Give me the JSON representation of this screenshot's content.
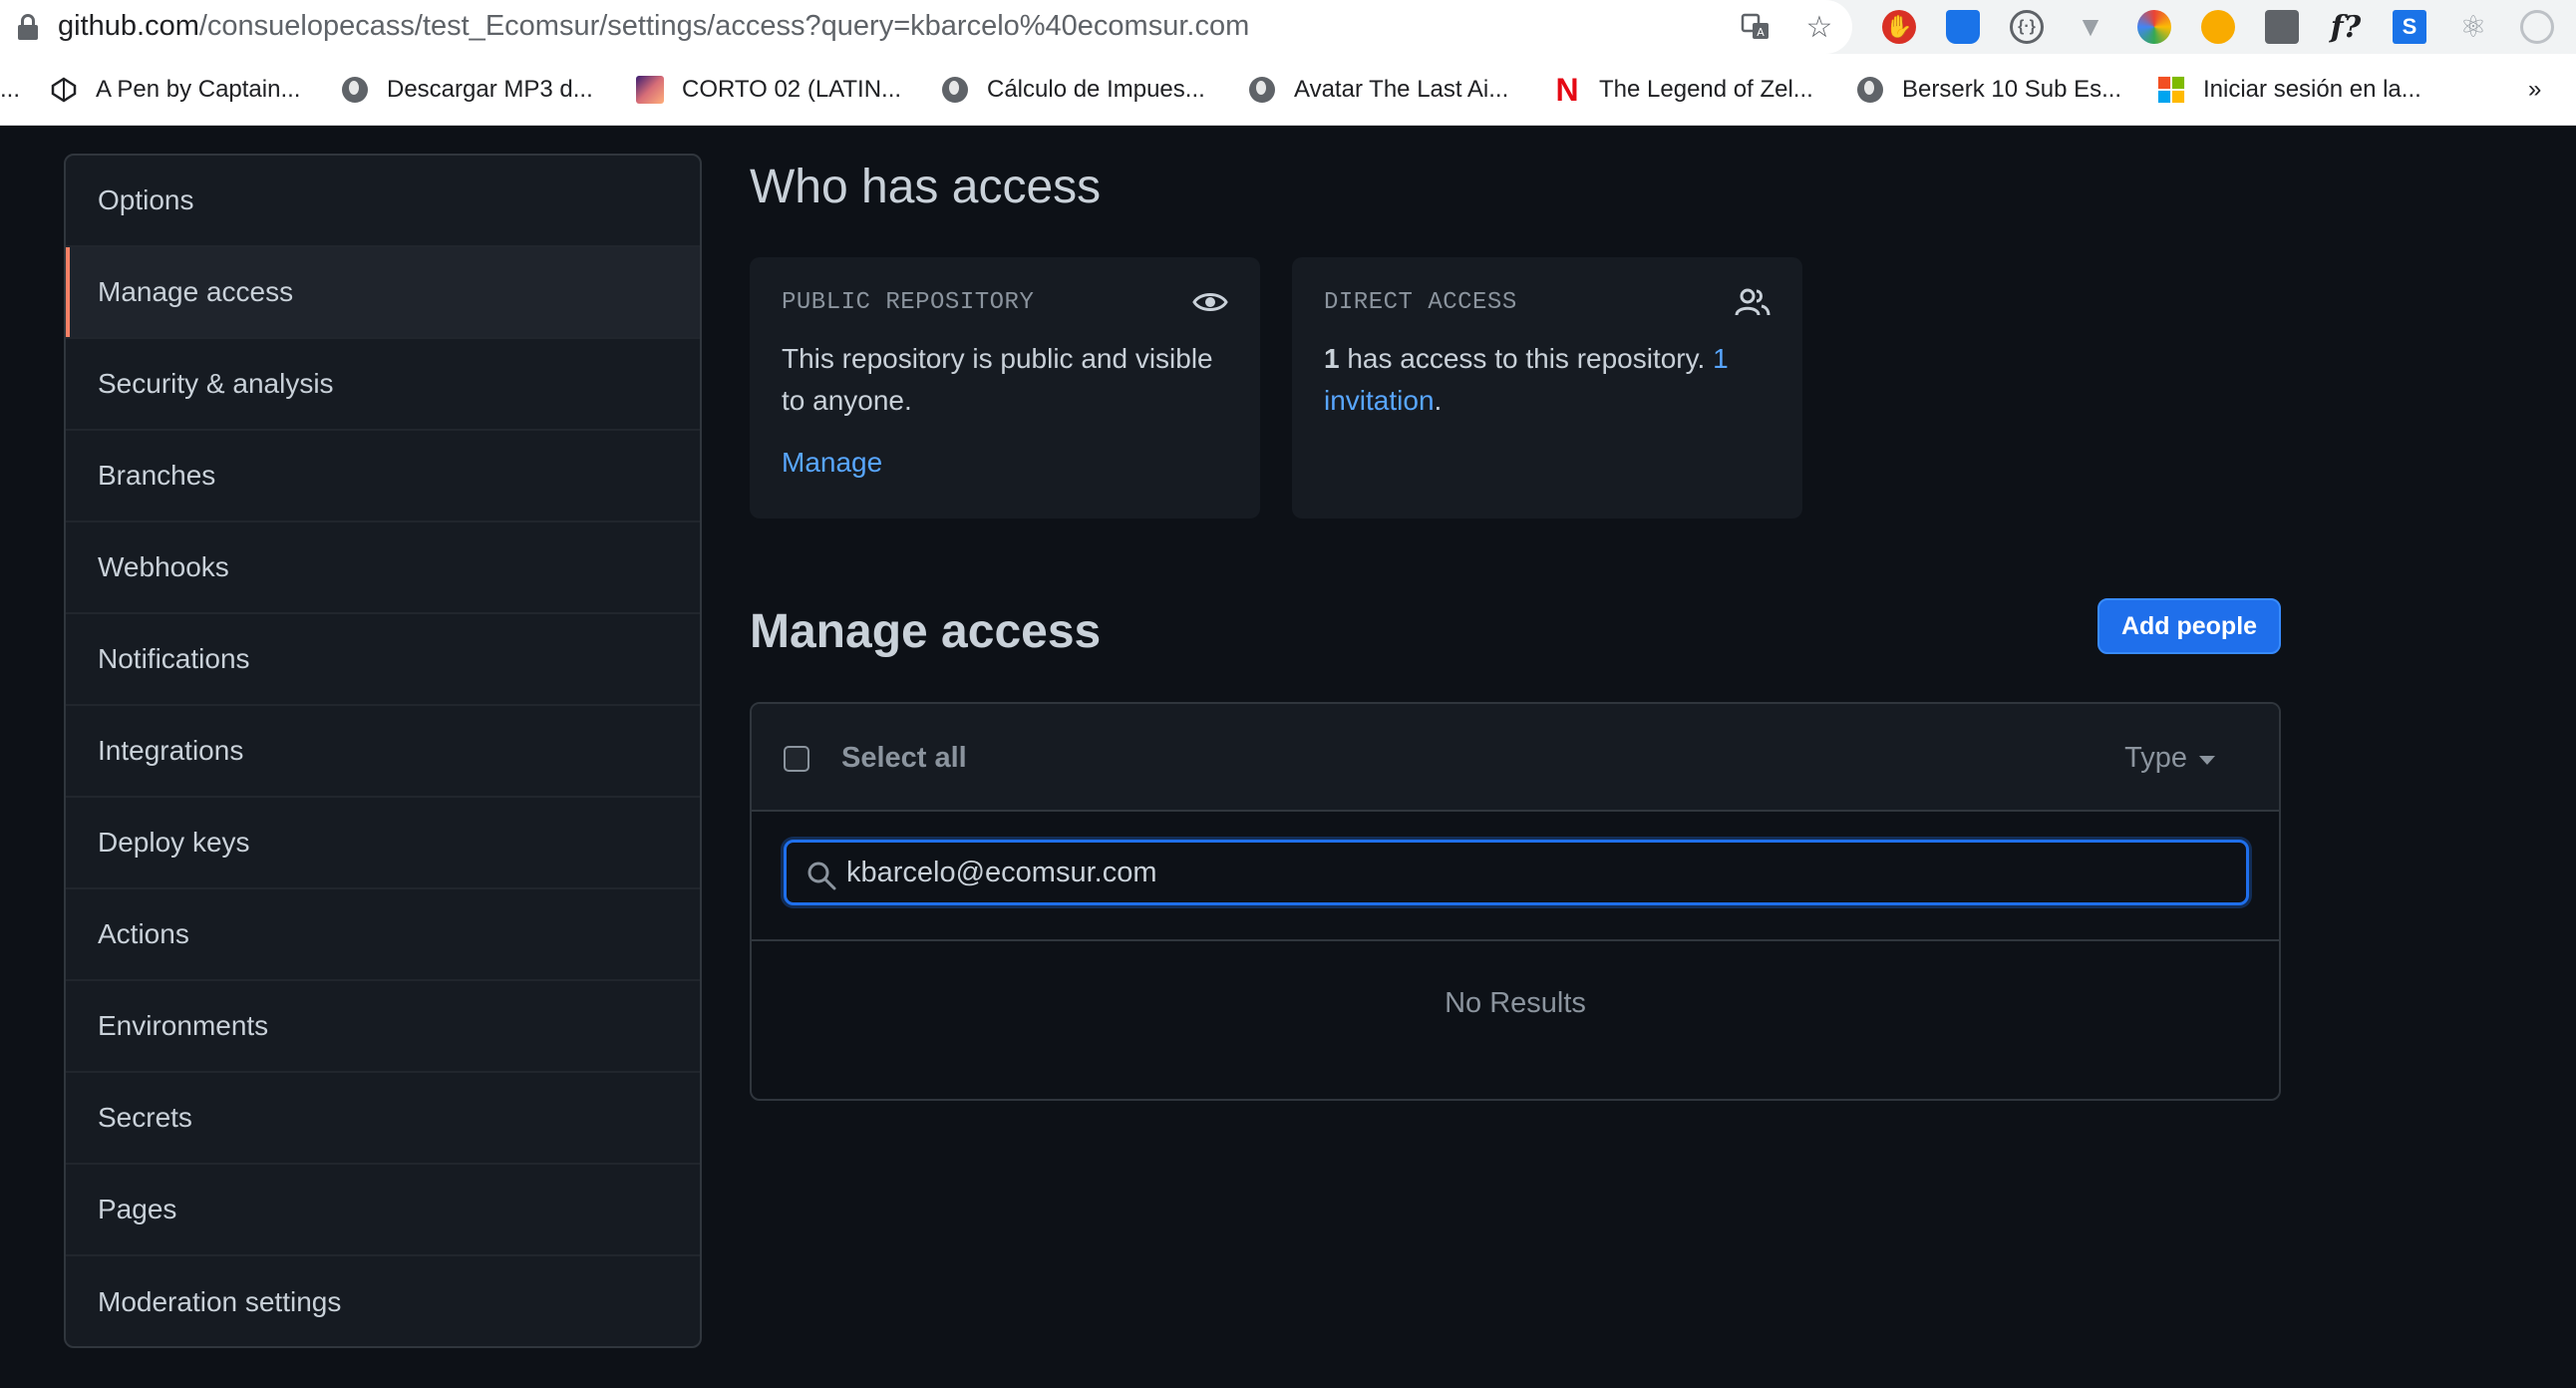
{
  "browser": {
    "url_host": "github.com",
    "url_path": "/consuelopecass/test_Ecomsur/settings/access?query=kbarcelo%40ecomsur.com",
    "bookmarks": [
      {
        "label": "A Pen by Captain...",
        "icon": "codepen-icon"
      },
      {
        "label": "Descargar MP3 d...",
        "icon": "globe-icon"
      },
      {
        "label": "CORTO 02 (LATIN...",
        "icon": "image-favicon"
      },
      {
        "label": "Cálculo de Impues...",
        "icon": "globe-icon"
      },
      {
        "label": "Avatar The Last Ai...",
        "icon": "globe-icon"
      },
      {
        "label": "The Legend of Zel...",
        "icon": "netflix-icon"
      },
      {
        "label": "Berserk 10 Sub Es...",
        "icon": "globe-icon"
      },
      {
        "label": "Iniciar sesión en la...",
        "icon": "microsoft-icon"
      }
    ],
    "overflow_label": "»",
    "left_fragment": "..."
  },
  "sidebar": {
    "items": [
      {
        "label": "Options"
      },
      {
        "label": "Manage access",
        "selected": true
      },
      {
        "label": "Security & analysis"
      },
      {
        "label": "Branches"
      },
      {
        "label": "Webhooks"
      },
      {
        "label": "Notifications"
      },
      {
        "label": "Integrations"
      },
      {
        "label": "Deploy keys"
      },
      {
        "label": "Actions"
      },
      {
        "label": "Environments"
      },
      {
        "label": "Secrets"
      },
      {
        "label": "Pages"
      },
      {
        "label": "Moderation settings"
      }
    ]
  },
  "who": {
    "heading": "Who has access",
    "public_card": {
      "label": "PUBLIC REPOSITORY",
      "text": "This repository is public and visible to anyone.",
      "link": "Manage"
    },
    "direct_card": {
      "label": "DIRECT ACCESS",
      "count": "1",
      "text": " has access to this repository. ",
      "invite_link": "1 invitation",
      "suffix": "."
    }
  },
  "manage": {
    "heading": "Manage access",
    "add_button": "Add people",
    "select_all": "Select all",
    "type_filter": "Type",
    "search_value": "kbarcelo@ecomsur.com",
    "empty_text": "No Results"
  },
  "colors": {
    "accent": "#1f6feb",
    "link": "#58a6ff",
    "selected_marker": "#f78166",
    "background": "#0d1117"
  }
}
